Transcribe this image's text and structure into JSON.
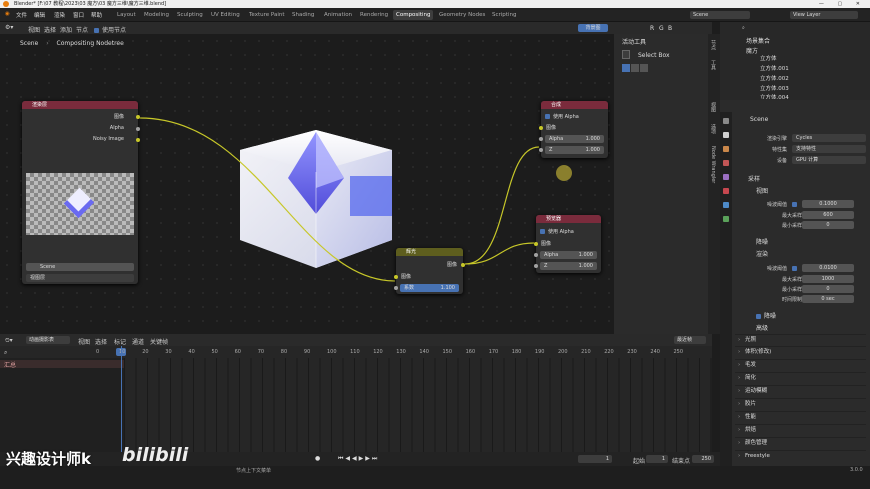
{
  "window": {
    "title": "Blender* [F:\\07 教程\\2023\\03 魔方\\03 魔方三维\\魔方三维.blend]"
  },
  "menu": [
    "文件",
    "编辑",
    "渲染",
    "窗口",
    "帮助"
  ],
  "workspaces": [
    "Layout",
    "Modeling",
    "Sculpting",
    "UV Editing",
    "Texture Paint",
    "Shading",
    "Animation",
    "Rendering",
    "Compositing",
    "Geometry Nodes",
    "Scripting"
  ],
  "active_workspace": "Compositing",
  "scene_field": "Scene",
  "view_layer_field": "View Layer",
  "node_header": {
    "menus": [
      "视图",
      "选择",
      "添加",
      "节点"
    ],
    "use_nodes": "使用节点",
    "backdrop": "背景图",
    "channels": [
      "R",
      "G",
      "B"
    ]
  },
  "breadcrumb": {
    "scene": "Scene",
    "tree": "Compositing Nodetree"
  },
  "nodes": {
    "render_layers": {
      "title": "渲染层",
      "out_image": "图像",
      "out_alpha": "Alpha",
      "out_noisy": "Noisy Image",
      "scene": "Scene",
      "layer": "视图层"
    },
    "composite": {
      "title": "合成",
      "use_alpha": "使用 Alpha",
      "in_image": "图像",
      "alpha_label": "Alpha",
      "alpha_value": "1.000",
      "z_label": "Z",
      "z_value": "1.000"
    },
    "viewer": {
      "title": "预览器",
      "use_alpha": "使用 Alpha",
      "in_image": "图像",
      "alpha_label": "Alpha",
      "alpha_value": "1.000",
      "z_label": "Z",
      "z_value": "1.000"
    },
    "glare": {
      "title": "辉光",
      "in_image": "图像",
      "out_image": "图像",
      "fac_label": "系数",
      "fac_value": "1.100"
    }
  },
  "tool_panel": {
    "header": "活动工具",
    "tool": "Select Box"
  },
  "vertical_tabs": [
    "节点",
    "工具",
    "视图",
    "选项",
    "Node Wrangler"
  ],
  "outliner": {
    "header": "场景集合",
    "collection": "魔方",
    "objects": [
      "立方体",
      "立方体.001",
      "立方体.002",
      "立方体.003",
      "立方体.004"
    ]
  },
  "properties": {
    "scene": "Scene",
    "render_engine_label": "渲染引擎",
    "render_engine": "Cycles",
    "feature_set_label": "特性集",
    "feature_set": "支持特性",
    "device_label": "设备",
    "device": "GPU 计算",
    "sampling": "采样",
    "viewport": "视图",
    "vp_noise_label": "噪波阈值",
    "vp_noise": "0.1000",
    "vp_max_label": "最大采样",
    "vp_max": "600",
    "vp_min_label": "最小采样",
    "vp_min": "0",
    "denoise": "降噪",
    "render": "渲染",
    "r_noise_label": "噪波阈值",
    "r_noise": "0.0100",
    "r_max_label": "最大采样",
    "r_max": "1000",
    "r_min_label": "最小采样",
    "r_min": "0",
    "r_time_label": "时间限制",
    "r_time": "0 sec",
    "r_denoise": "降噪",
    "lights": "光照",
    "advanced": "高级",
    "sections": [
      "光程",
      "体积(修改)",
      "毛发",
      "简化",
      "运动模糊",
      "胶片",
      "性能",
      "烘焙",
      "颜色管理",
      "Freestyle"
    ]
  },
  "timeline": {
    "mode": "动画摄影表",
    "menus": [
      "视图",
      "选择",
      "标记",
      "通道",
      "关键帧"
    ],
    "summary": "汇总",
    "current": "1",
    "ticks": [
      "0",
      "10",
      "20",
      "30",
      "40",
      "50",
      "60",
      "70",
      "80",
      "90",
      "100",
      "110",
      "120",
      "130",
      "140",
      "150",
      "160",
      "170",
      "180",
      "190",
      "200",
      "210",
      "220",
      "230",
      "240",
      "250"
    ],
    "current_frame": "1",
    "start_label": "起始",
    "start": "1",
    "end_label": "结束点",
    "end": "250",
    "filter": "最近帧"
  },
  "status": {
    "hint": "节点上下文菜单",
    "version": "3.0.0",
    "watermark": "兴趣设计师k",
    "brand": "bilibili"
  }
}
